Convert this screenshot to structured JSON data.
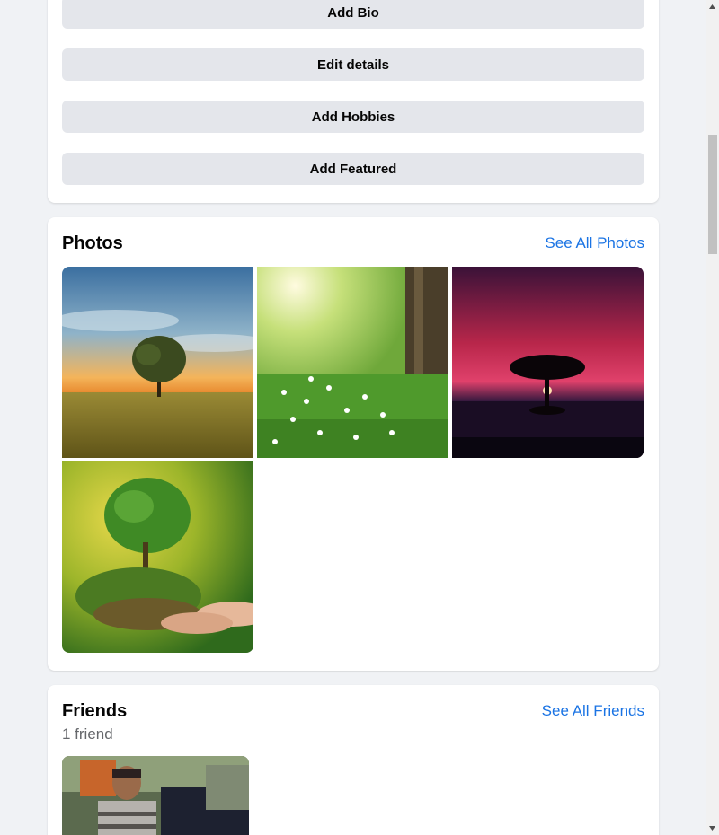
{
  "intro": {
    "add_bio": "Add Bio",
    "edit_details": "Edit details",
    "add_hobbies": "Add Hobbies",
    "add_featured": "Add Featured"
  },
  "photos": {
    "title": "Photos",
    "see_all": "See All Photos",
    "items": [
      {
        "icon": "tree-field-sunset-photo"
      },
      {
        "icon": "tree-grass-flowers-photo"
      },
      {
        "icon": "tree-red-sky-photo"
      },
      {
        "icon": "tree-in-hand-photo"
      }
    ]
  },
  "friends": {
    "title": "Friends",
    "see_all": "See All Friends",
    "count": "1 friend"
  },
  "colors": {
    "accent": "#1b74e4",
    "button_bg": "#e4e6eb",
    "page_bg": "#f0f2f5",
    "muted_text": "#65676b"
  }
}
